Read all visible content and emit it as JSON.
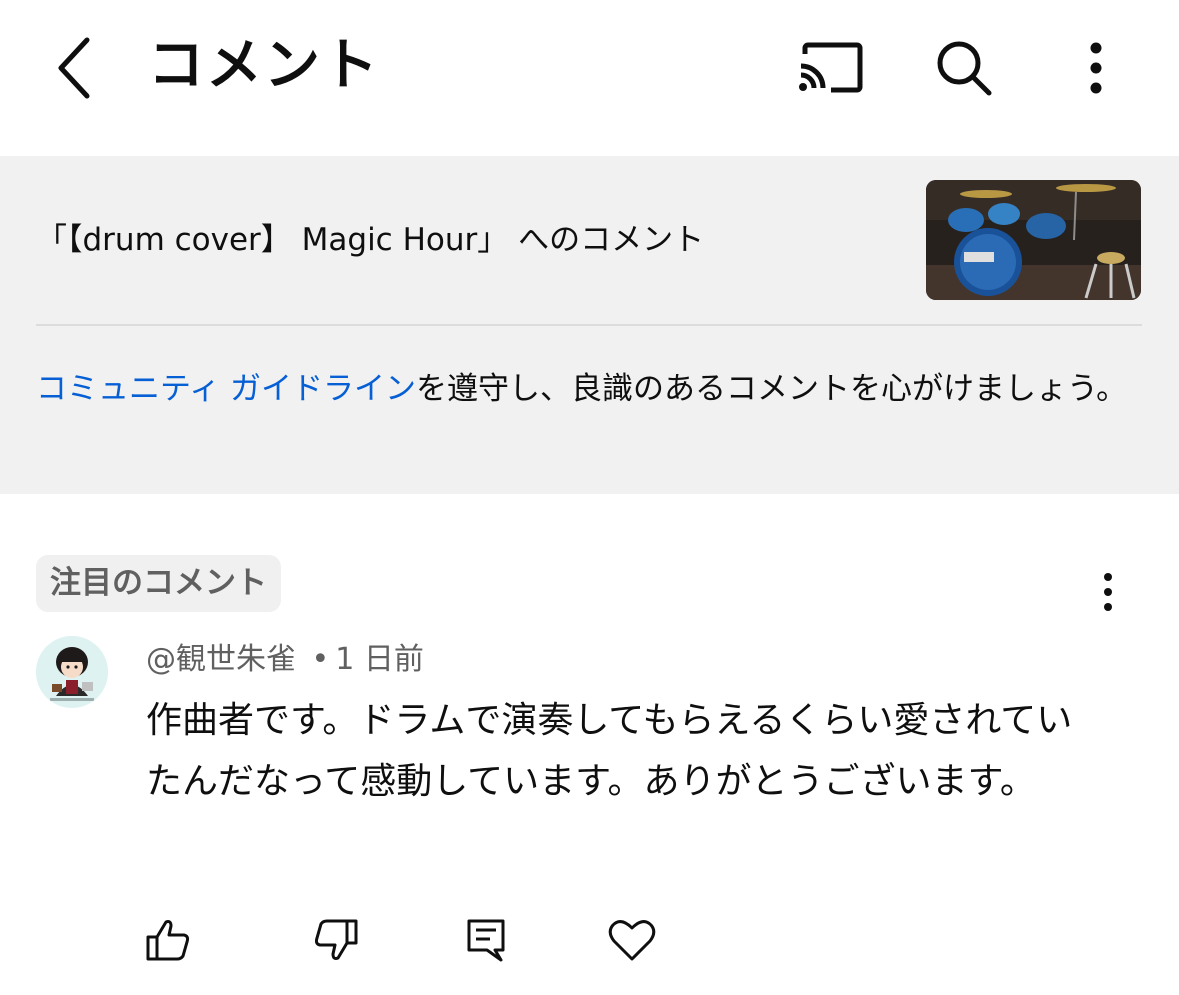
{
  "header": {
    "title": "コメント",
    "back_icon": "chevron-left-icon",
    "cast_icon": "cast-icon",
    "search_icon": "search-icon",
    "more_icon": "more-vertical-icon"
  },
  "video": {
    "title": "「【drum  cover】 Magic Hour」 へのコメント"
  },
  "guidelines": {
    "link_text": "コミュニティ ガイドライン",
    "rest_text": "を遵守し、良識のあるコメントを心がけましょう。"
  },
  "comment": {
    "badge": "注目のコメント",
    "author": "@観世朱雀",
    "separator": "•",
    "time": "1 日前",
    "body": "作曲者です。ドラムで演奏してもらえるくらい愛されていたんだなって感動しています。ありがとうございます。"
  },
  "colors": {
    "link": "#065fd4",
    "panel_bg": "#f1f1f1",
    "secondary_text": "#606060"
  }
}
